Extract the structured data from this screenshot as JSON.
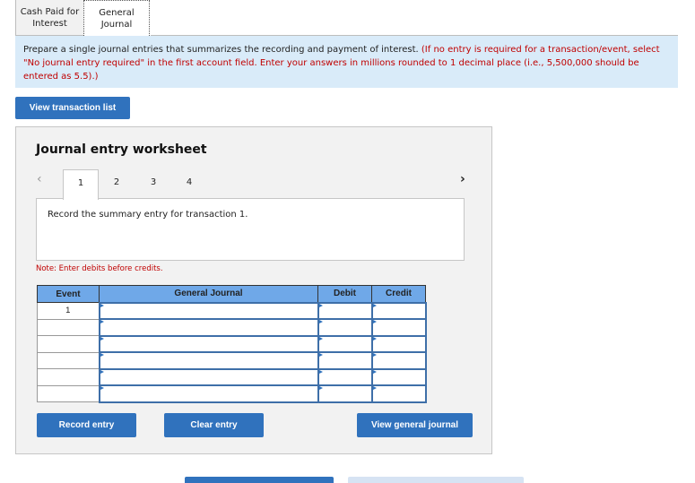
{
  "tabs": [
    {
      "label": "Cash Paid for Interest",
      "active": false
    },
    {
      "label": "General Journal",
      "active": true
    }
  ],
  "instructions": {
    "main": "Prepare a single journal entries that summarizes the recording and payment of interest.",
    "note": "(If no entry is required for a transaction/event, select \"No journal entry required\" in the first account field. Enter your answers in millions rounded to 1 decimal place (i.e., 5,500,000 should be entered as 5.5).)"
  },
  "buttons": {
    "view_transaction_list": "View transaction list",
    "record_entry": "Record entry",
    "clear_entry": "Clear entry",
    "view_general_journal": "View general journal"
  },
  "worksheet": {
    "title": "Journal entry worksheet",
    "prev_icon": "‹",
    "next_icon": "›",
    "pages": [
      "1",
      "2",
      "3",
      "4"
    ],
    "active_page": "1",
    "description": "Record the summary entry for transaction 1.",
    "note": "Note: Enter debits before credits."
  },
  "journal_table": {
    "headers": {
      "event": "Event",
      "general_journal": "General Journal",
      "debit": "Debit",
      "credit": "Credit"
    },
    "rows": [
      {
        "event": "1",
        "account": "",
        "debit": "",
        "credit": ""
      },
      {
        "event": "",
        "account": "",
        "debit": "",
        "credit": ""
      },
      {
        "event": "",
        "account": "",
        "debit": "",
        "credit": ""
      },
      {
        "event": "",
        "account": "",
        "debit": "",
        "credit": ""
      },
      {
        "event": "",
        "account": "",
        "debit": "",
        "credit": ""
      },
      {
        "event": "",
        "account": "",
        "debit": "",
        "credit": ""
      }
    ]
  },
  "colors": {
    "primary_button": "#3072bd",
    "instruction_bg": "#d9ebf9",
    "table_header": "#6fa8e8",
    "note_red": "#c00000"
  }
}
